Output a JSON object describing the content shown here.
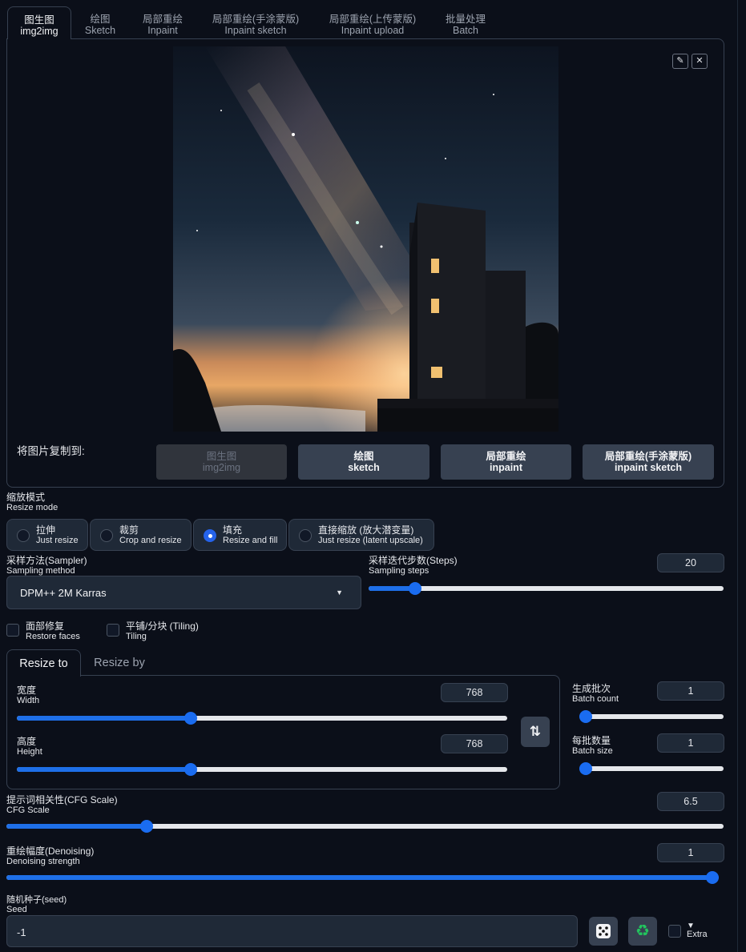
{
  "tabs": [
    {
      "cn": "图生图",
      "en": "img2img"
    },
    {
      "cn": "绘图",
      "en": "Sketch"
    },
    {
      "cn": "局部重绘",
      "en": "Inpaint"
    },
    {
      "cn": "局部重绘(手涂蒙版)",
      "en": "Inpaint sketch"
    },
    {
      "cn": "局部重绘(上传蒙版)",
      "en": "Inpaint upload"
    },
    {
      "cn": "批量处理",
      "en": "Batch"
    }
  ],
  "image_tools": {
    "edit_icon": "pencil-icon",
    "close_icon": "close-icon"
  },
  "copy_to": {
    "label": "将图片复制到:",
    "buttons": [
      {
        "cn": "图生图",
        "en": "img2img",
        "disabled": true
      },
      {
        "cn": "绘图",
        "en": "sketch"
      },
      {
        "cn": "局部重绘",
        "en": "inpaint"
      },
      {
        "cn": "局部重绘(手涂蒙版)",
        "en": "inpaint sketch"
      }
    ]
  },
  "resize_mode": {
    "label_cn": "缩放模式",
    "label_en": "Resize mode",
    "options": [
      {
        "cn": "拉伸",
        "en": "Just resize"
      },
      {
        "cn": "裁剪",
        "en": "Crop and resize"
      },
      {
        "cn": "填充",
        "en": "Resize and fill"
      },
      {
        "cn": "直接缩放 (放大潜变量)",
        "en": "Just resize (latent upscale)"
      }
    ],
    "selected_index": 2
  },
  "sampler": {
    "label_cn": "采样方法(Sampler)",
    "label_en": "Sampling method",
    "value": "DPM++ 2M Karras"
  },
  "steps": {
    "label_cn": "采样迭代步数(Steps)",
    "label_en": "Sampling steps",
    "value": "20",
    "fraction": 0.13
  },
  "restore_faces": {
    "cn": "面部修复",
    "en": "Restore faces",
    "checked": false
  },
  "tiling": {
    "cn": "平铺/分块 (Tiling)",
    "en": "Tiling",
    "checked": false
  },
  "size_tabs": [
    "Resize to",
    "Resize by"
  ],
  "width": {
    "label_cn": "宽度",
    "label_en": "Width",
    "value": "768",
    "fraction": 0.355
  },
  "height": {
    "label_cn": "高度",
    "label_en": "Height",
    "value": "768",
    "fraction": 0.355
  },
  "swap_icon": "swap-arrows-icon",
  "batch_count": {
    "label_cn": "生成批次",
    "label_en": "Batch count",
    "value": "1",
    "fraction": 0.0
  },
  "batch_size": {
    "label_cn": "每批数量",
    "label_en": "Batch size",
    "value": "1",
    "fraction": 0.0
  },
  "cfg_scale": {
    "label_cn": "提示词相关性(CFG Scale)",
    "label_en": "CFG Scale",
    "value": "6.5",
    "fraction": 0.195
  },
  "denoising": {
    "label_cn": "重绘幅度(Denoising)",
    "label_en": "Denoising strength",
    "value": "1",
    "fraction": 1.0
  },
  "seed": {
    "label_cn": "随机种子(seed)",
    "label_en": "Seed",
    "value": "-1",
    "dice_icon": "dice-icon",
    "recycle_icon": "recycle-icon"
  },
  "extra": {
    "arrow": "▼",
    "label": "Extra",
    "checked": false
  }
}
